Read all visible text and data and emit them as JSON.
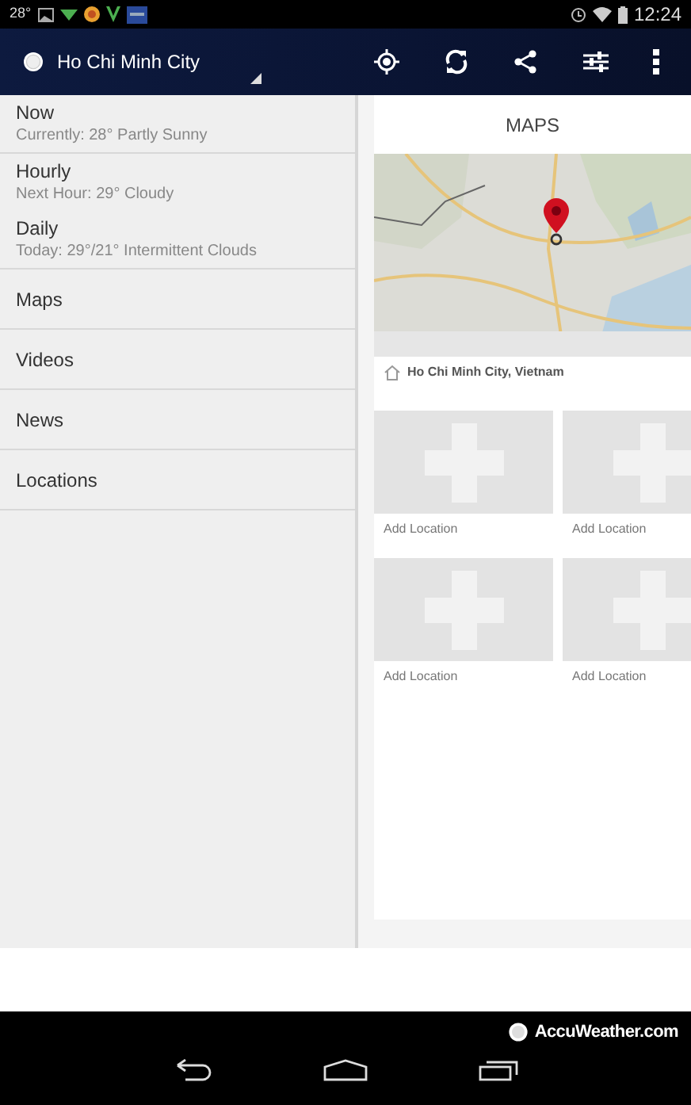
{
  "status_bar": {
    "temperature": "28°",
    "time": "12:24"
  },
  "app_bar": {
    "location": "Ho Chi Minh City"
  },
  "sidebar": {
    "sections": [
      {
        "items": [
          {
            "title": "Now",
            "subtitle": "Currently: 28° Partly Sunny"
          }
        ]
      },
      {
        "items": [
          {
            "title": "Hourly",
            "subtitle": "Next Hour: 29° Cloudy"
          },
          {
            "title": "Daily",
            "subtitle": "Today: 29°/21° Intermittent Clouds"
          }
        ]
      },
      {
        "items": [
          {
            "title": "Maps"
          }
        ]
      },
      {
        "items": [
          {
            "title": "Videos"
          }
        ]
      },
      {
        "items": [
          {
            "title": "News"
          }
        ]
      },
      {
        "items": [
          {
            "title": "Locations"
          }
        ]
      }
    ]
  },
  "panel": {
    "title": "MAPS",
    "map": {
      "caption": "Ho Chi Minh City, Vietnam"
    },
    "tiles": [
      {
        "label": "Add Location"
      },
      {
        "label": "Add Location"
      },
      {
        "label": "Add Location"
      },
      {
        "label": "Add Location"
      }
    ]
  },
  "footer": {
    "brand": "AccuWeather.com"
  }
}
